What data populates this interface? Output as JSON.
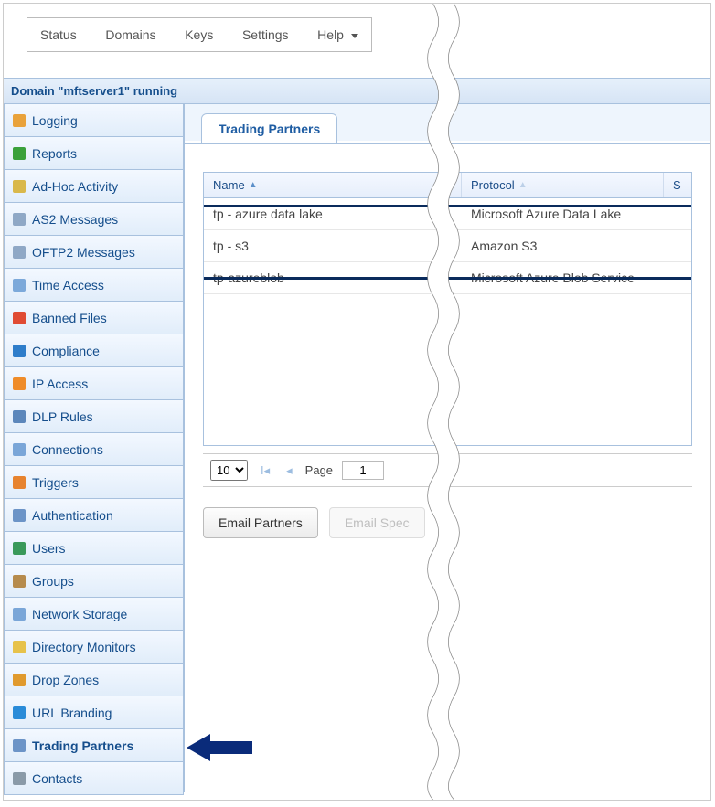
{
  "topMenu": {
    "status": "Status",
    "domains": "Domains",
    "keys": "Keys",
    "settings": "Settings",
    "help": "Help"
  },
  "domainBar": "Domain \"mftserver1\" running",
  "sidebar": {
    "items": [
      {
        "label": "Logging",
        "icon": "logging-icon",
        "color": "#e9a23b"
      },
      {
        "label": "Reports",
        "icon": "reports-icon",
        "color": "#3ba13b"
      },
      {
        "label": "Ad-Hoc Activity",
        "icon": "adhoc-icon",
        "color": "#d9b84a"
      },
      {
        "label": "AS2 Messages",
        "icon": "as2-icon",
        "color": "#8fa8c6"
      },
      {
        "label": "OFTP2 Messages",
        "icon": "oftp2-icon",
        "color": "#8fa8c6"
      },
      {
        "label": "Time Access",
        "icon": "time-icon",
        "color": "#7ca9da"
      },
      {
        "label": "Banned Files",
        "icon": "banned-icon",
        "color": "#e04b33"
      },
      {
        "label": "Compliance",
        "icon": "compliance-icon",
        "color": "#2e7dca"
      },
      {
        "label": "IP Access",
        "icon": "ip-icon",
        "color": "#ef8c2a"
      },
      {
        "label": "DLP Rules",
        "icon": "dlp-icon",
        "color": "#5c87bb"
      },
      {
        "label": "Connections",
        "icon": "connections-icon",
        "color": "#7aa6d8"
      },
      {
        "label": "Triggers",
        "icon": "triggers-icon",
        "color": "#e7832f"
      },
      {
        "label": "Authentication",
        "icon": "auth-icon",
        "color": "#6c94c7"
      },
      {
        "label": "Users",
        "icon": "users-icon",
        "color": "#3a995a"
      },
      {
        "label": "Groups",
        "icon": "groups-icon",
        "color": "#b68b4d"
      },
      {
        "label": "Network Storage",
        "icon": "storage-icon",
        "color": "#7aa6d8"
      },
      {
        "label": "Directory Monitors",
        "icon": "dirmon-icon",
        "color": "#e7c24a"
      },
      {
        "label": "Drop Zones",
        "icon": "dropzone-icon",
        "color": "#e09a2e"
      },
      {
        "label": "URL Branding",
        "icon": "url-icon",
        "color": "#2a8bd8"
      },
      {
        "label": "Trading Partners",
        "icon": "tp-icon",
        "color": "#6c94c7",
        "active": true
      },
      {
        "label": "Contacts",
        "icon": "contacts-icon",
        "color": "#8a9aa8"
      }
    ]
  },
  "tab": {
    "title": "Trading Partners"
  },
  "table": {
    "columns": {
      "name": "Name",
      "protocol": "Protocol",
      "extraShort": "S"
    },
    "rows": [
      {
        "name": "tp - azure data lake",
        "protocol": "Microsoft Azure Data Lake"
      },
      {
        "name": "tp - s3",
        "protocol": "Amazon S3"
      },
      {
        "name": "tp-azureblob",
        "protocol": "Microsoft Azure Blob Service"
      }
    ]
  },
  "pager": {
    "pageSize": "10",
    "pageSizeOptions": [
      "10"
    ],
    "pageLabel": "Page",
    "page": "1"
  },
  "buttons": {
    "emailPartners": "Email Partners",
    "emailSpec": "Email Spec"
  }
}
